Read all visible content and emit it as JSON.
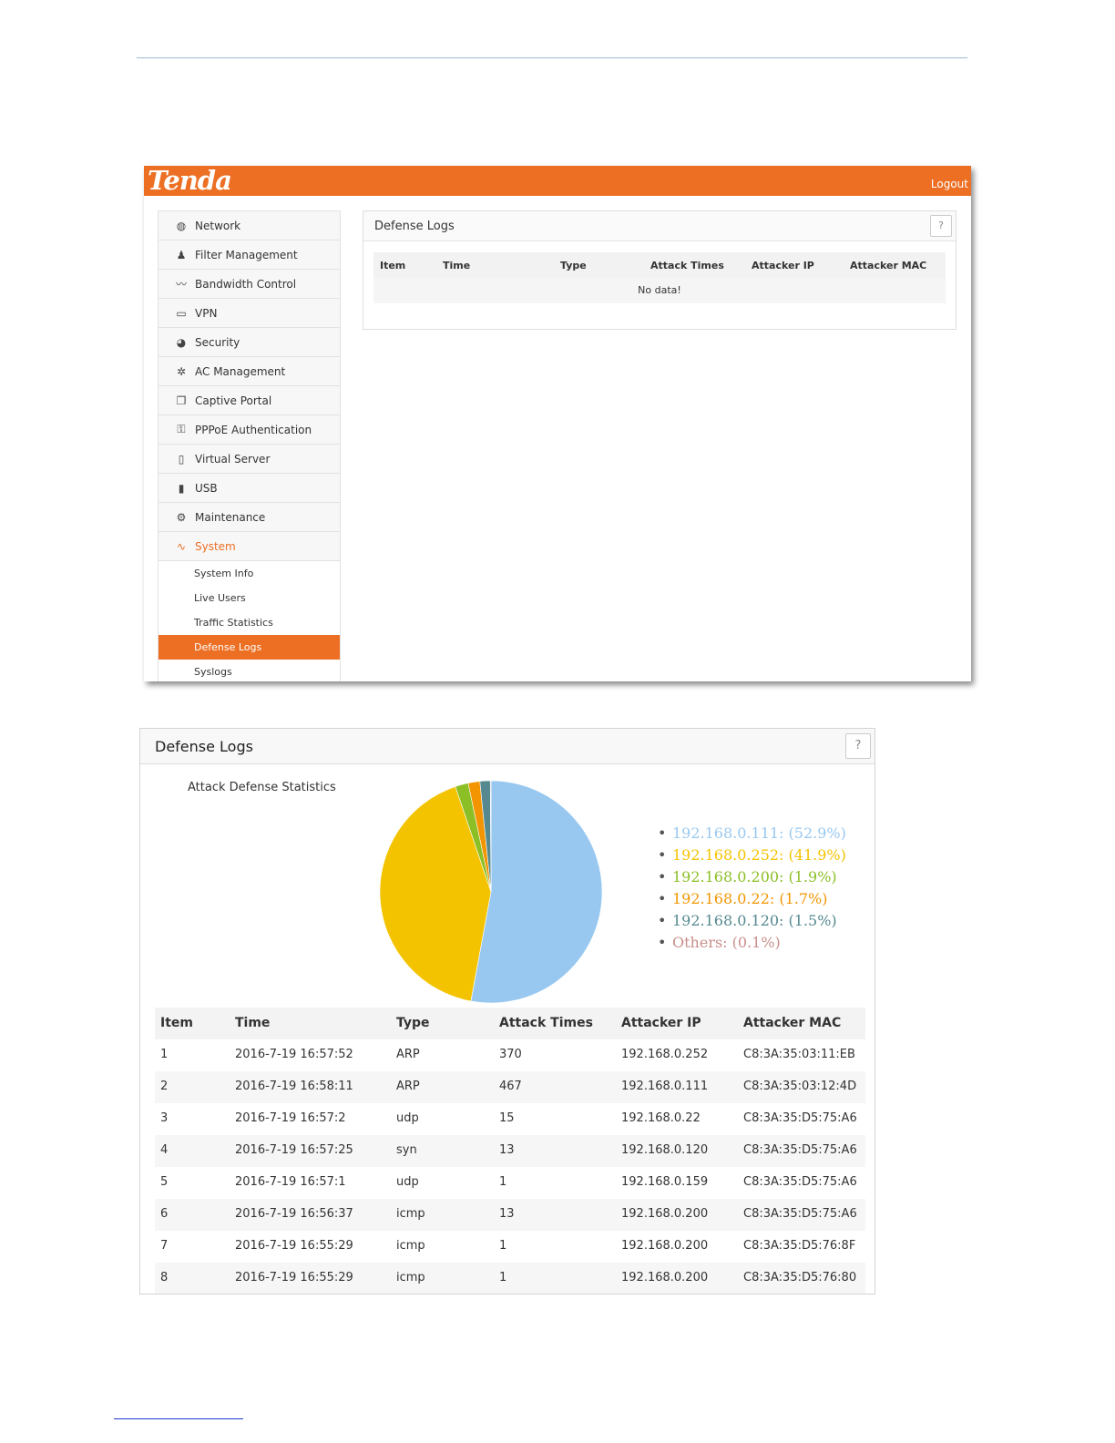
{
  "top_screenshot": {
    "brand": "Tenda",
    "logout": "Logout",
    "sidebar": {
      "items": [
        {
          "label": "Network",
          "icon": "globe-icon",
          "glyph": "◍"
        },
        {
          "label": "Filter Management",
          "icon": "user-filter-icon",
          "glyph": "♟"
        },
        {
          "label": "Bandwidth Control",
          "icon": "bandwidth-icon",
          "glyph": "〰"
        },
        {
          "label": "VPN",
          "icon": "monitor-icon",
          "glyph": "▭"
        },
        {
          "label": "Security",
          "icon": "security-icon",
          "glyph": "◕"
        },
        {
          "label": "AC Management",
          "icon": "ac-management-icon",
          "glyph": "✲"
        },
        {
          "label": "Captive Portal",
          "icon": "captive-portal-icon",
          "glyph": "❐"
        },
        {
          "label": "PPPoE Authentication",
          "icon": "pppoe-icon",
          "glyph": "⚿"
        },
        {
          "label": "Virtual Server",
          "icon": "server-icon",
          "glyph": "▯"
        },
        {
          "label": "USB",
          "icon": "usb-icon",
          "glyph": "▮"
        },
        {
          "label": "Maintenance",
          "icon": "gears-icon",
          "glyph": "⚙"
        },
        {
          "label": "System",
          "icon": "pulse-icon",
          "glyph": "∿"
        }
      ],
      "subitems": [
        "System Info",
        "Live Users",
        "Traffic Statistics",
        "Defense Logs",
        "Syslogs"
      ]
    },
    "panel": {
      "title": "Defense Logs",
      "help": "?",
      "columns": [
        "Item",
        "Time",
        "Type",
        "Attack Times",
        "Attacker IP",
        "Attacker MAC"
      ],
      "empty": "No data!"
    }
  },
  "bottom_screenshot": {
    "title": "Defense Logs",
    "help": "?",
    "stats_title": "Attack Defense Statistics",
    "legend": [
      {
        "text": "192.168.0.111: (52.9%)",
        "color": "#98c8f0"
      },
      {
        "text": "192.168.0.252: (41.9%)",
        "color": "#f4c300"
      },
      {
        "text": "192.168.0.200: (1.9%)",
        "color": "#8cbf26"
      },
      {
        "text": "192.168.0.22: (1.7%)",
        "color": "#f29500"
      },
      {
        "text": "192.168.0.120: (1.5%)",
        "color": "#55898f"
      },
      {
        "text": "Others: (0.1%)",
        "color": "#c88f8a"
      }
    ],
    "columns": [
      "Item",
      "Time",
      "Type",
      "Attack Times",
      "Attacker IP",
      "Attacker MAC"
    ],
    "rows": [
      [
        "1",
        "2016-7-19 16:57:52",
        "ARP",
        "370",
        "192.168.0.252",
        "C8:3A:35:03:11:EB"
      ],
      [
        "2",
        "2016-7-19 16:58:11",
        "ARP",
        "467",
        "192.168.0.111",
        "C8:3A:35:03:12:4D"
      ],
      [
        "3",
        "2016-7-19 16:57:2",
        "udp",
        "15",
        "192.168.0.22",
        "C8:3A:35:D5:75:A6"
      ],
      [
        "4",
        "2016-7-19 16:57:25",
        "syn",
        "13",
        "192.168.0.120",
        "C8:3A:35:D5:75:A6"
      ],
      [
        "5",
        "2016-7-19 16:57:1",
        "udp",
        "1",
        "192.168.0.159",
        "C8:3A:35:D5:75:A6"
      ],
      [
        "6",
        "2016-7-19 16:56:37",
        "icmp",
        "13",
        "192.168.0.200",
        "C8:3A:35:D5:75:A6"
      ],
      [
        "7",
        "2016-7-19 16:55:29",
        "icmp",
        "1",
        "192.168.0.200",
        "C8:3A:35:D5:76:8F"
      ],
      [
        "8",
        "2016-7-19 16:55:29",
        "icmp",
        "1",
        "192.168.0.200",
        "C8:3A:35:D5:76:80"
      ]
    ]
  },
  "chart_data": {
    "type": "pie",
    "title": "Attack Defense Statistics",
    "categories": [
      "192.168.0.111",
      "192.168.0.252",
      "192.168.0.200",
      "192.168.0.22",
      "192.168.0.120",
      "Others"
    ],
    "values": [
      52.9,
      41.9,
      1.9,
      1.7,
      1.5,
      0.1
    ],
    "colors": [
      "#98c8f0",
      "#f4c300",
      "#8cbf26",
      "#f29500",
      "#55898f",
      "#c88f8a"
    ],
    "legend": "right"
  }
}
